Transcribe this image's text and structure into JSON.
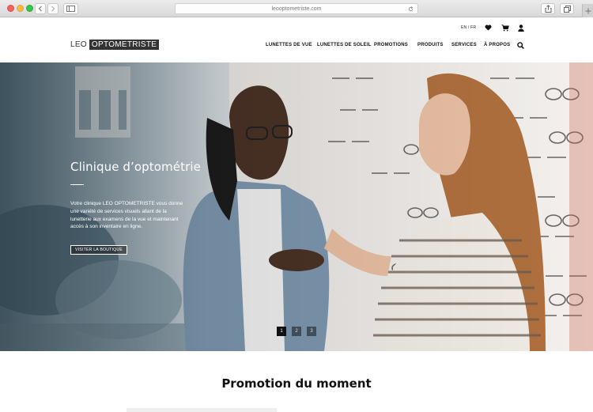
{
  "browser": {
    "url": "leooptometriste.com"
  },
  "header": {
    "logo_part1": "LEO",
    "logo_part2": "OPTOMETRISTE",
    "language_switch": "EN / FR",
    "nav": [
      "LUNETTES DE VUE",
      "LUNETTES DE SOLEIL",
      "PROMOTIONS",
      "PRODUITS",
      "SERVICES",
      "À PROPOS"
    ],
    "icons": [
      "heart-icon",
      "cart-icon",
      "user-icon",
      "search-icon"
    ]
  },
  "hero": {
    "title": "Clinique d’optométrie",
    "text": "Votre clinique LEO OPTOMETRISTE vous donne une variété de services visuels allant de la lunetterie aux examens de la vue et maintenant accès à son inventaire en ligne.",
    "button": "VISITER LA BOUTIQUE",
    "pager": [
      "1",
      "2",
      "3"
    ],
    "active_slide": "1"
  },
  "promo": {
    "title": "Promotion du moment"
  },
  "colors": {
    "text_dark": "#111111",
    "logo_bg": "#333333",
    "accent_white": "#ffffff"
  }
}
